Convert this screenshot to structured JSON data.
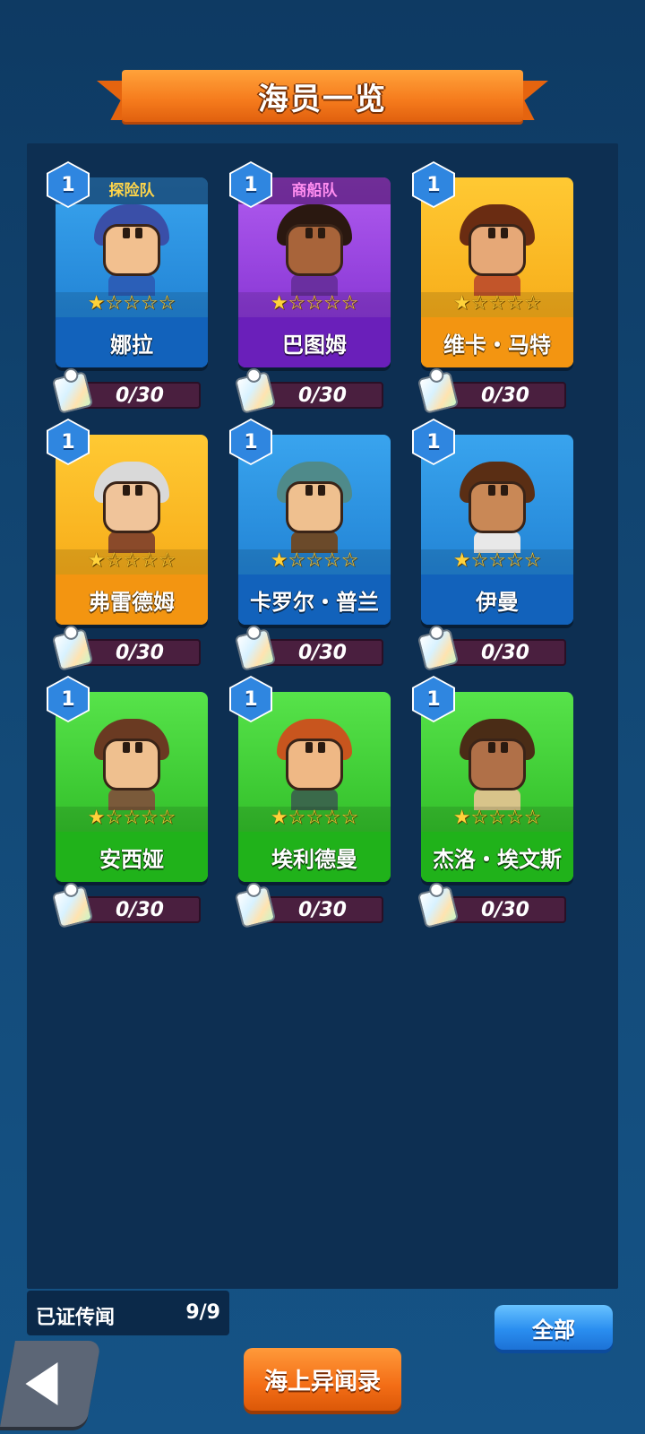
{
  "header": {
    "title": "海员一览"
  },
  "sailors": [
    {
      "name": "娜拉",
      "level": "1",
      "tag": "探险队",
      "progress": "0/30",
      "stars": "★☆☆☆☆",
      "theme": "blue",
      "hair": "#3a4fa8",
      "skin": "#f2c08f",
      "body": "#2b5fb8"
    },
    {
      "name": "巴图姆",
      "level": "1",
      "tag": "商船队",
      "progress": "0/30",
      "stars": "★☆☆☆☆",
      "theme": "purple",
      "hair": "#2a1810",
      "skin": "#a8643a",
      "body": "#6a2fa0"
    },
    {
      "name": "维卡・马特",
      "level": "1",
      "tag": "",
      "progress": "0/30",
      "stars": "★☆☆☆☆",
      "theme": "gold",
      "hair": "#6a2c12",
      "skin": "#e6a877",
      "body": "#c2552a"
    },
    {
      "name": "弗雷德姆",
      "level": "1",
      "tag": "",
      "progress": "0/30",
      "stars": "★☆☆☆☆",
      "theme": "gold",
      "hair": "#d9d9d9",
      "skin": "#f0c49a",
      "body": "#8a4a2a"
    },
    {
      "name": "卡罗尔・普兰",
      "level": "1",
      "tag": "",
      "progress": "0/30",
      "stars": "★☆☆☆☆",
      "theme": "blue",
      "hair": "#4f8a8a",
      "skin": "#efc08f",
      "body": "#6b4a2a"
    },
    {
      "name": "伊曼",
      "level": "1",
      "tag": "",
      "progress": "0/30",
      "stars": "★☆☆☆☆",
      "theme": "blue",
      "hair": "#5a2e14",
      "skin": "#c98856",
      "body": "#e8e8e8"
    },
    {
      "name": "安西娅",
      "level": "1",
      "tag": "",
      "progress": "0/30",
      "stars": "★☆☆☆☆",
      "theme": "green",
      "hair": "#6a3a22",
      "skin": "#efc08f",
      "body": "#7a5a3a"
    },
    {
      "name": "埃利德曼",
      "level": "1",
      "tag": "",
      "progress": "0/30",
      "stars": "★☆☆☆☆",
      "theme": "green",
      "hair": "#c8551e",
      "skin": "#efb885",
      "body": "#3a6a4a"
    },
    {
      "name": "杰洛・埃文斯",
      "level": "1",
      "tag": "",
      "progress": "0/30",
      "stars": "★☆☆☆☆",
      "theme": "green",
      "hair": "#4a2c16",
      "skin": "#b07048",
      "body": "#d8c48a"
    }
  ],
  "footer": {
    "legend_label": "已证传闻",
    "legend_value": "9/9",
    "all_button": "全部",
    "log_button": "海上异闻录"
  },
  "icons": {
    "back": "back-arrow-icon",
    "puzzle": "puzzle-piece-icon",
    "level": "level-hexagon-icon",
    "star": "star-icon"
  },
  "colors": {
    "background": "#134a78",
    "panel": "#0d2f52",
    "banner": "#f57a1c",
    "progress_bg": "#4a1f3f"
  }
}
